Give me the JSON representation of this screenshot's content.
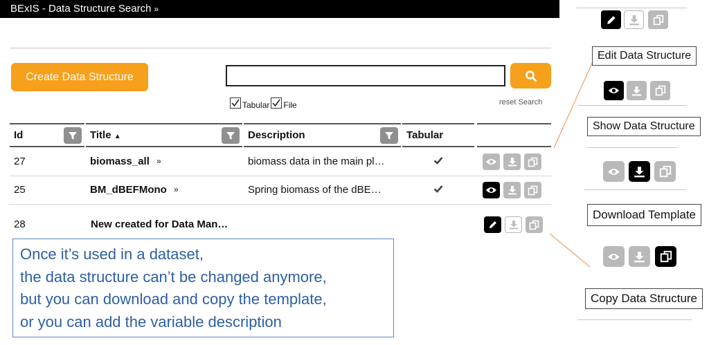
{
  "header": {
    "title": "BExIS - Data Structure Search",
    "chevron": "»"
  },
  "toolbar": {
    "create_label": "Create Data Structure",
    "search_value": "",
    "search_icon": "search-icon"
  },
  "filters": {
    "tabular_label": "Tabular",
    "file_label": "File",
    "tabular_checked": true,
    "file_checked": true,
    "reset_label": "reset Search"
  },
  "table": {
    "columns": [
      "Id",
      "Title",
      "Description",
      "Tabular"
    ],
    "sort_indicator": "▲",
    "rows": [
      {
        "id": "27",
        "title": "biomass_all",
        "description": "biomass data in the main pl…",
        "tabular": true,
        "expand": "»"
      },
      {
        "id": "25",
        "title": "BM_dBEFMono",
        "description": "Spring biomass of the dBE…",
        "tabular": true,
        "expand": "»"
      },
      {
        "id": "28",
        "title": "New created for Data Man…",
        "description": "",
        "tabular": false,
        "expand": ""
      }
    ]
  },
  "note": {
    "lines": [
      "Once it’s used in a dataset,",
      "the data structure can’t be changed anymore,",
      "but you can download and copy the template,",
      "or you can add the variable description"
    ]
  },
  "legend": {
    "edit_label": "Edit Data Structure",
    "show_label": "Show Data Structure",
    "download_label": "Download Template",
    "copy_label": "Copy Data Structure"
  },
  "colors": {
    "accent": "#f7a01b",
    "note_text": "#2e5fa3",
    "callout_line": "#f0a060"
  }
}
